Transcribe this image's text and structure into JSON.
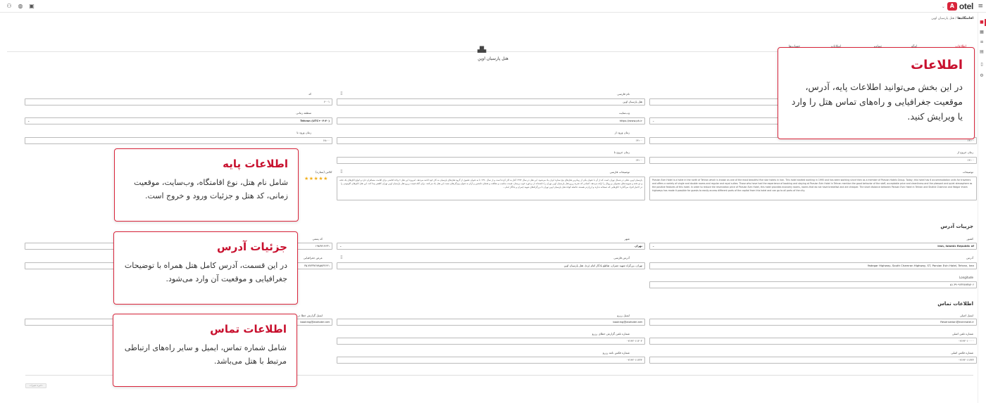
{
  "topbar": {
    "brand_text": "otel",
    "brand_mark": "A",
    "chevron": "⌄",
    "menu_icon": "≡"
  },
  "breadcrumb": {
    "root": "اقامتگاه‌ها",
    "separator": " / ",
    "current": "هتل پارسیان اوین"
  },
  "tabs": [
    "اطلاعات",
    "لوگو",
    "تصاویر",
    "امکانات",
    "حساب‌ها"
  ],
  "hotel_title": "هتل پارسیان اوین",
  "basic": {
    "name_fa_label": "نام فارسی",
    "name_fa_value": "هتل پارسیان اوین",
    "code_label": "کد",
    "code_value": "۶۰۰۱",
    "website_label": "وب‌سایت",
    "website_value": "https://www.ph.ir",
    "timezone_label": "منطقه زمانی",
    "timezone_value": "Tehran (UTC+۰۳:۳۰)",
    "checkin_from_label": "زمان ورود از",
    "checkin_from_value": "۱۴:۰۰",
    "checkin_to_label": "زمان ورود تا",
    "checkin_to_value": "۱۸:۰۰",
    "checkout_from_label": "زمان خروج از",
    "checkout_from_value": "۱۲:۰۰",
    "checkout_to_label": "زمان خروج تا",
    "checkout_to_value": "۱۴:۰۰",
    "right_col_val1": "۱۲:۰۰",
    "desc_en_label": "توضیحات",
    "desc_en_value": "Parsian Evin Hotel is a hotel in the north of Tehran which is known as one of the most beautiful five star hotels in Iran. This hotel started working in 1995 and has been working since then as a member of Parsian Hotels Group. Today, this hotel has 6 accommodation units for travelers and offers a variety of single and double rooms and regular and royal suites. Those who have had the experience of booking and staying at Parsian Evin Hotel in Tehran mention the good behavior of the staff, acceptable price and cleanliness and the pleasant and quiet atmosphere as the positive features of this hotel. In order to reduce the reservation price of Parsian Evin Hotel, this hotel provides economy rooms, rooms that do not have breakfast and are cheaper. The short distance between Parsian Evin Hotel in Tehran and Shahid Chamran and Yadgar Imam highways has made it possible for guests to easily access different parts of the capital from this hotel and can go to all parts of the city.",
    "desc_fa_label": "توضیحات فارسی",
    "desc_fa_value": "پارسیان اوین، هتلی در شمال تهران است که از آن با عنوان یکی از زیباترین هتل‌های پنج ستاره ایران یاد می‌شود. این هتل در سال ۱۳۷۴ آغاز به کار کرده است و از سال ۱۳۷۰ تا به عنوان عضوی از گروه هتل‌های پارسیان به کار خود ادامه می‌دهد. امروزه این هتل ۶ واحد اقامتی برای اقامت مسافران دارد و انواع اتاق‌های یک تخته و دو تخته و سوییت‌های معمولی و رویال را ارائه می‌دهد. کسانی که تجربه رزرو هتل پارسیان اوین تهران را داشته‌اند از برخورد خوب پرسنل، قیمت مناسب و نظافت و فضای دلنشین و آرام به عنوان ویژگی‌های مثبت این هتل یاد می‌کنند. برای آنکه قیمت رزرو هتل پارسیان اوین تهران کاهش پیدا کند، این هتل اتاق‌های اکونومی را در اختیار افراد می‌گذارد؛ اتاق‌هایی که صبحانه ندارند و ارزان‌تر هستند. فاصله کوتاه هتل پارسیان اوین تهران تا بزرگراه‌های شهید چمران و یادگار امام...",
    "stars_label": "کلاس (ستاره)",
    "stars_value": "★★★★★"
  },
  "address": {
    "section_title": "جزییات آدرس",
    "country_label": "کشور",
    "country_value": "Iran, Islamic Republic of",
    "city_label": "شهر",
    "city_value": "تهران",
    "postal_label": "کد پستی",
    "postal_value": "۱۹۸۳۷۱۴۶۳۱",
    "address_en_label": "آدرس",
    "address_en_value": "Yadegar Highway, South Chamran Highway, ST, Parsian Evin Hotel, Tehran, Iran",
    "address_fa_label": "آدرس فارسی",
    "address_fa_value": "تهران، بزرگراه شهید چمران، تقاطع یادگار امام (ره)، هتل پارسیان اوین",
    "latitude_label": "عرض جغرافیایی",
    "latitude_value": "۳۵.۷۷۳۳۷۶۷۸۵۸۳۲۶۴۱",
    "longitude_label": "Longitude",
    "longitude_value": "۵۱.۳۹۰۹۲۳۲۸۹۳۸۷۰۶"
  },
  "contact": {
    "section_title": "اطلاعات تماس",
    "email_main_label": "ایمیل اصلی",
    "email_main_value": "Reservation@evinhotel.ir",
    "email_booking_label": "ایمیل رزرو",
    "email_booking_value": "booking@alohotel.net",
    "email_notify_label": "ایمیل گزارش خطا در رزرو",
    "email_notify_value": "booking@alohotel.net",
    "phone_main_label": "شماره تلفن اصلی",
    "phone_main_value": "۰۲۱۴۲۰۱۰۰۰۰",
    "phone_booking_label": "شماره تلفن گزارش خطای رزرو",
    "phone_booking_value": "۰۲۱۴۲۰۱۱۲۰۲",
    "fax_main_label": "شماره فکس اصلی",
    "fax_main_value": "۰۲۱۴۲۰۱۱۲۲۲",
    "fax_booking_label": "شماره فکس نامه رزرو",
    "fax_booking_value": "۰۲۱۴۲۰۱۱۲۲۲"
  },
  "save_button": "ذخیره تغییرات",
  "callouts": {
    "info_title": "اطلاعات",
    "info_body": "در این بخش می‌توانید اطلاعات پایه، آدرس، موقعیت جغرافیایی و راه‌های تماس هتل را وارد یا ویرایش کنید.",
    "basic_title": "اطلاعات پایه",
    "basic_body": "شامل نام هتل، نوع اقامتگاه، وب‌سایت، موقعیت زمانی، کد هتل و جزئیات ورود و خروج است.",
    "address_title": "جزئیات آدرس",
    "address_body": "در این قسمت، آدرس کامل هتل همراه با توضیحات جغرافیایی و موقعیت آن وارد می‌شود.",
    "contact_title": "اطلاعات تماس",
    "contact_body": "شامل شماره تماس، ایمیل و سایر راه‌های ارتباطی مرتبط با هتل می‌باشد."
  },
  "colors": {
    "accent": "#d9253b",
    "star": "#f2b01e"
  }
}
